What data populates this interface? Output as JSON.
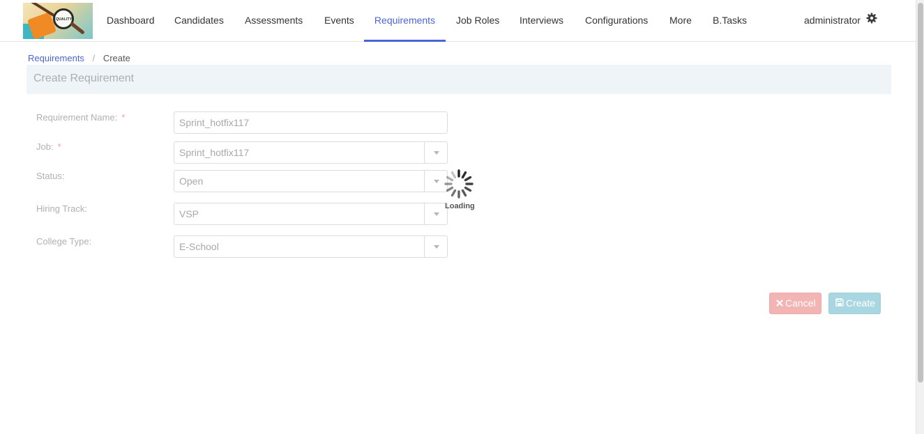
{
  "nav": {
    "logo_text": "QUALITY",
    "items": [
      {
        "label": "Dashboard"
      },
      {
        "label": "Candidates"
      },
      {
        "label": "Assessments"
      },
      {
        "label": "Events"
      },
      {
        "label": "Requirements",
        "active": true
      },
      {
        "label": "Job Roles"
      },
      {
        "label": "Interviews"
      },
      {
        "label": "Configurations"
      },
      {
        "label": "More"
      },
      {
        "label": "B.Tasks"
      }
    ],
    "user": "administrator",
    "user_icon": "gear-icon",
    "accent_color": "#4a64d6"
  },
  "breadcrumb": {
    "link": "Requirements",
    "separator": "/",
    "current": "Create"
  },
  "panel": {
    "title": "Create Requirement"
  },
  "form": {
    "requirement_name": {
      "label": "Requirement Name:",
      "required": "*",
      "value": "Sprint_hotfix117"
    },
    "job": {
      "label": "Job:",
      "required": "*",
      "value": "Sprint_hotfix117"
    },
    "status": {
      "label": "Status:",
      "value": "Open"
    },
    "hiring_track": {
      "label": "Hiring Track:",
      "value": "VSP"
    },
    "college_type": {
      "label": "College Type:",
      "value": "E-School"
    }
  },
  "buttons": {
    "cancel": {
      "label": "Cancel",
      "icon": "close-icon",
      "color": "#f3b4b4"
    },
    "create": {
      "label": "Create",
      "icon": "save-icon",
      "color": "#a9d7e1"
    }
  },
  "loading": {
    "text": "Loading"
  }
}
